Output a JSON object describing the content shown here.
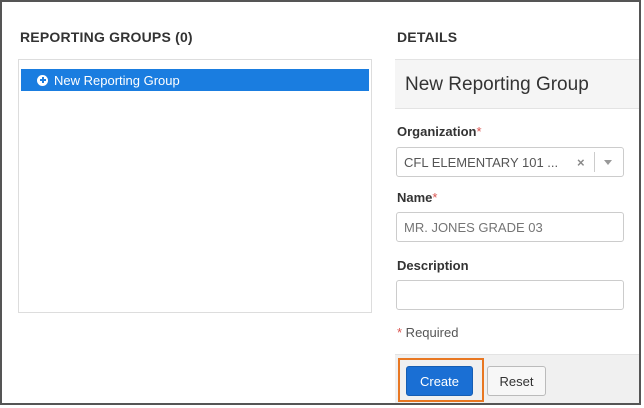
{
  "left_panel": {
    "title": "REPORTING GROUPS (0)",
    "items": [
      {
        "label": "New Reporting Group",
        "icon": "plus-circle-icon",
        "selected": true
      }
    ]
  },
  "right_panel": {
    "title": "DETAILS",
    "header": "New Reporting Group",
    "organization": {
      "label": "Organization",
      "required_mark": "*",
      "value": "CFL ELEMENTARY 101 ...",
      "clear_glyph": "×"
    },
    "name": {
      "label": "Name",
      "required_mark": "*",
      "placeholder": "MR. JONES GRADE 03",
      "value": ""
    },
    "description": {
      "label": "Description",
      "value": ""
    },
    "required_note": {
      "mark": "*",
      "text": " Required"
    },
    "buttons": {
      "create": "Create",
      "reset": "Reset"
    }
  },
  "colors": {
    "selected_item": "#1a7de0",
    "primary_button": "#1a6fd4",
    "required_mark": "#d9534f",
    "highlight_box": "#e87722"
  }
}
